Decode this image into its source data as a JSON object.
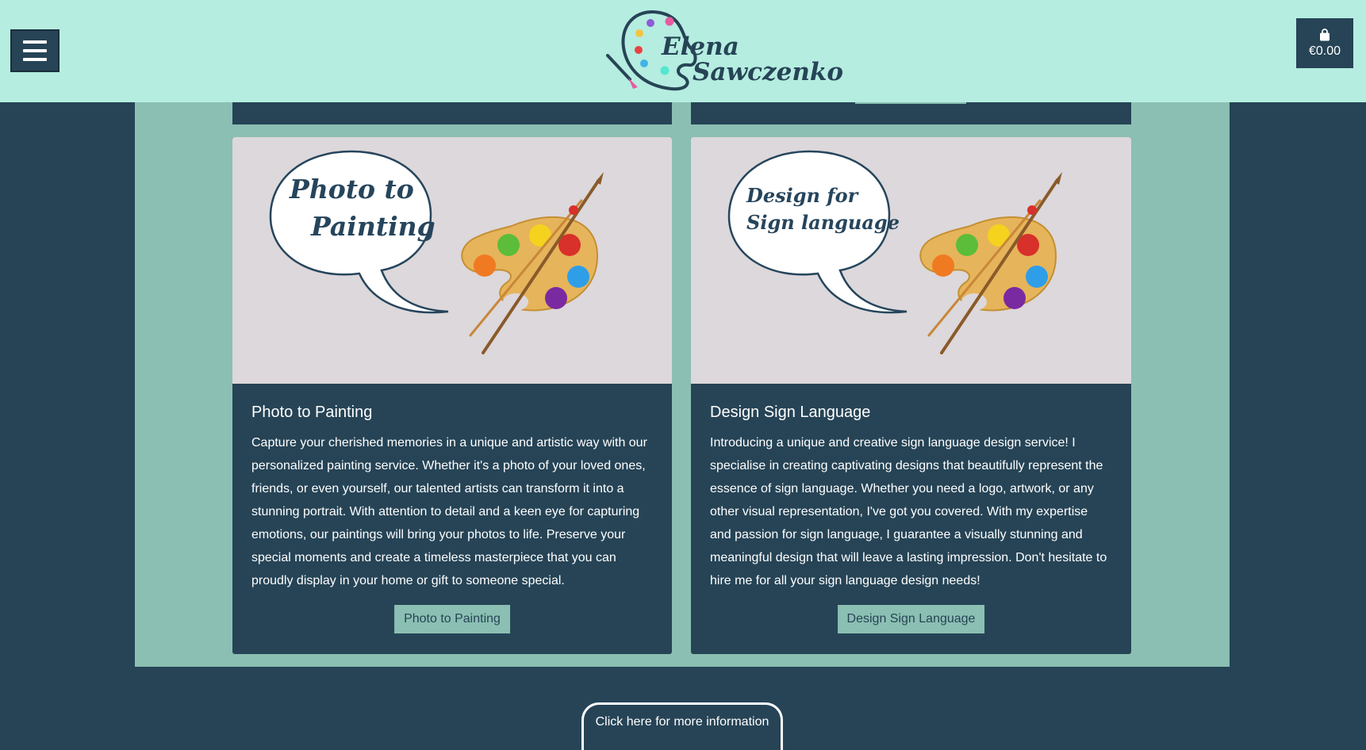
{
  "header": {
    "logo_first": "Elena",
    "logo_last": "Sawczenko",
    "cart_total": "€0.00"
  },
  "cards": [
    {
      "image_line1": "Photo to",
      "image_line2": "Painting",
      "title": "Photo to Painting",
      "description": "Capture your cherished memories in a unique and artistic way with our personalized painting service. Whether it's a photo of your loved ones, friends, or even yourself, our talented artists can transform it into a stunning portrait. With attention to detail and a keen eye for capturing emotions, our paintings will bring your photos to life. Preserve your special moments and create a timeless masterpiece that you can proudly display in your home or gift to someone special.",
      "button": "Photo to Painting"
    },
    {
      "image_line1": "Design for",
      "image_line2": "Sign language",
      "title": "Design Sign Language",
      "description": "Introducing a unique and creative sign language design service! I specialise in creating captivating designs that beautifully represent the essence of sign language. Whether you need a logo, artwork, or any other visual representation, I've got you covered. With my expertise and passion for sign language, I guarantee a visually stunning and meaningful design that will leave a lasting impression. Don't hesitate to hire me for all your sign language design needs!",
      "button": "Design Sign Language"
    }
  ],
  "footer": {
    "info_tab": "Click here for more information"
  },
  "colors": {
    "header_bg": "#b5ede0",
    "page_bg": "#264456",
    "panel_bg": "#8bbfb3",
    "card_bg": "#264456",
    "image_bg": "#dcd8db"
  }
}
